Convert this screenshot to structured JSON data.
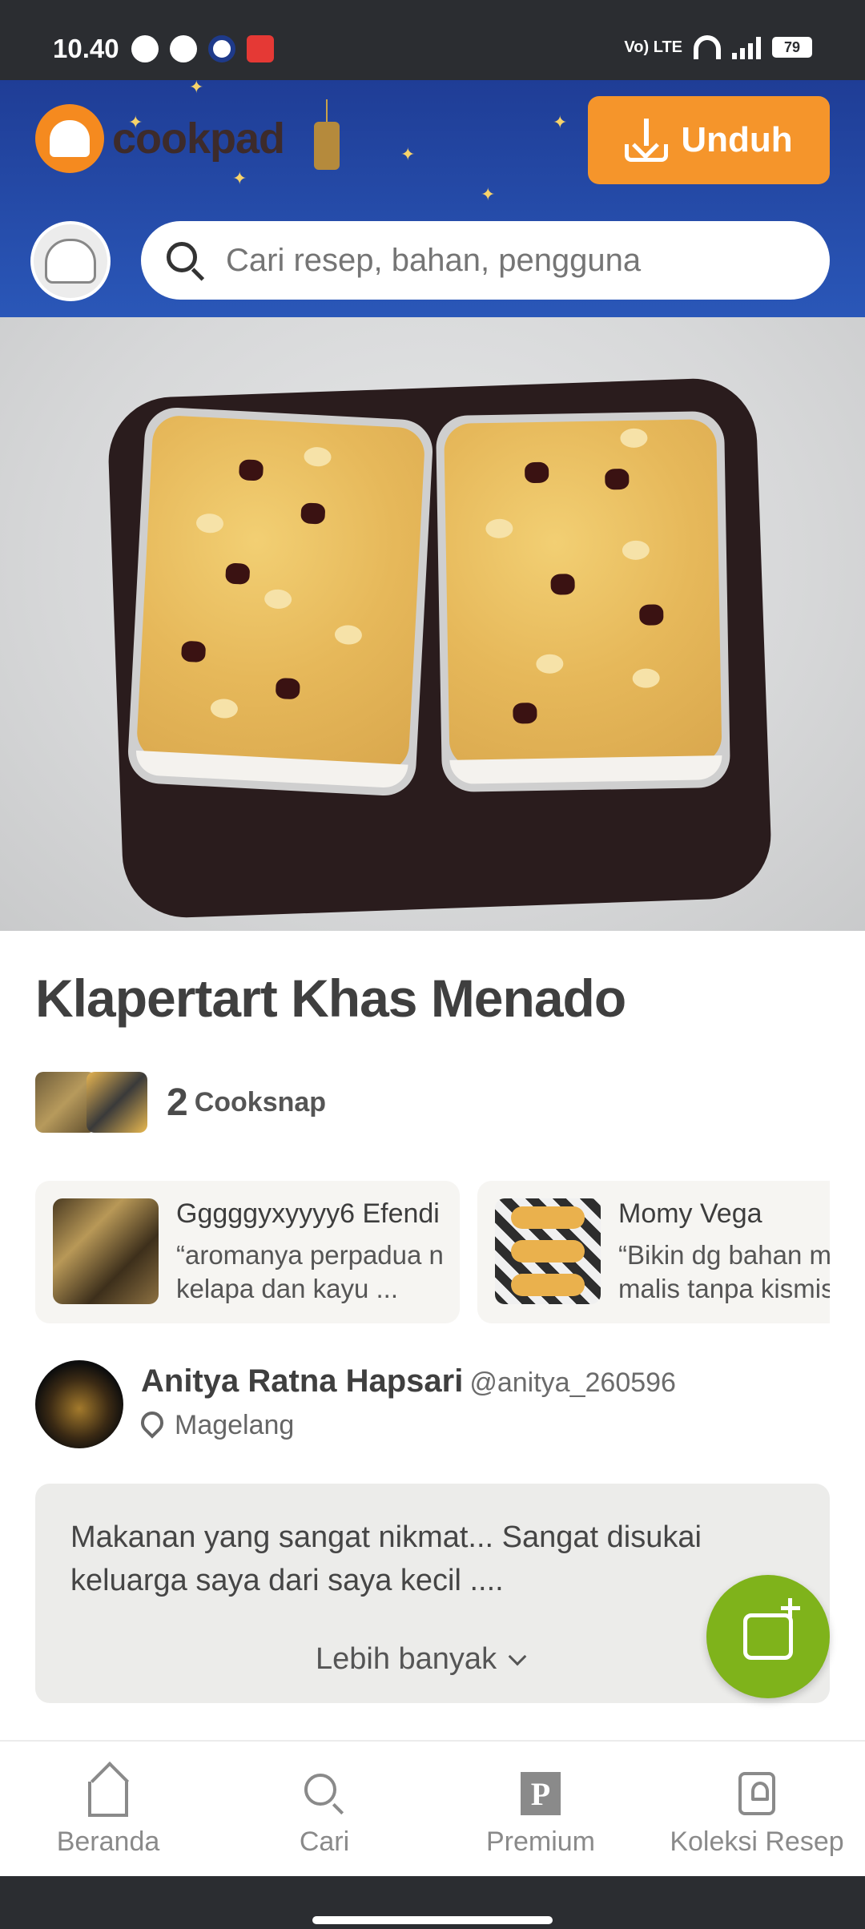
{
  "status_bar": {
    "time": "10.40",
    "network": "Vo) LTE",
    "battery": "79"
  },
  "header": {
    "logo_text": "cookpad",
    "download_label": "Unduh",
    "search_placeholder": "Cari resep, bahan, pengguna"
  },
  "recipe": {
    "title": "Klapertart Khas Menado",
    "cooksnap_count": "2",
    "cooksnap_label": "Cooksnap"
  },
  "cooksnaps": [
    {
      "name": "Gggggyxyyyy6 Efendi",
      "quote": "“aromanya perpadua n kelapa dan kayu ..."
    },
    {
      "name": "Momy Vega",
      "quote": "“Bikin dg bahan m malis tanpa kismis"
    }
  ],
  "author": {
    "name": "Anitya Ratna Hapsari",
    "handle": "@anitya_260596",
    "location": "Magelang"
  },
  "description": {
    "text": "Makanan yang sangat nikmat... Sangat disukai keluarga saya dari saya kecil ....",
    "more_label": "Lebih banyak"
  },
  "bottom_nav": [
    {
      "label": "Beranda",
      "icon": "home-icon"
    },
    {
      "label": "Cari",
      "icon": "search-icon"
    },
    {
      "label": "Premium",
      "icon": "premium-icon"
    },
    {
      "label": "Koleksi Resep",
      "icon": "collection-icon"
    }
  ],
  "colors": {
    "accent_orange": "#f5952b",
    "header_blue": "#2a57b8",
    "fab_green": "#7fb31b"
  }
}
